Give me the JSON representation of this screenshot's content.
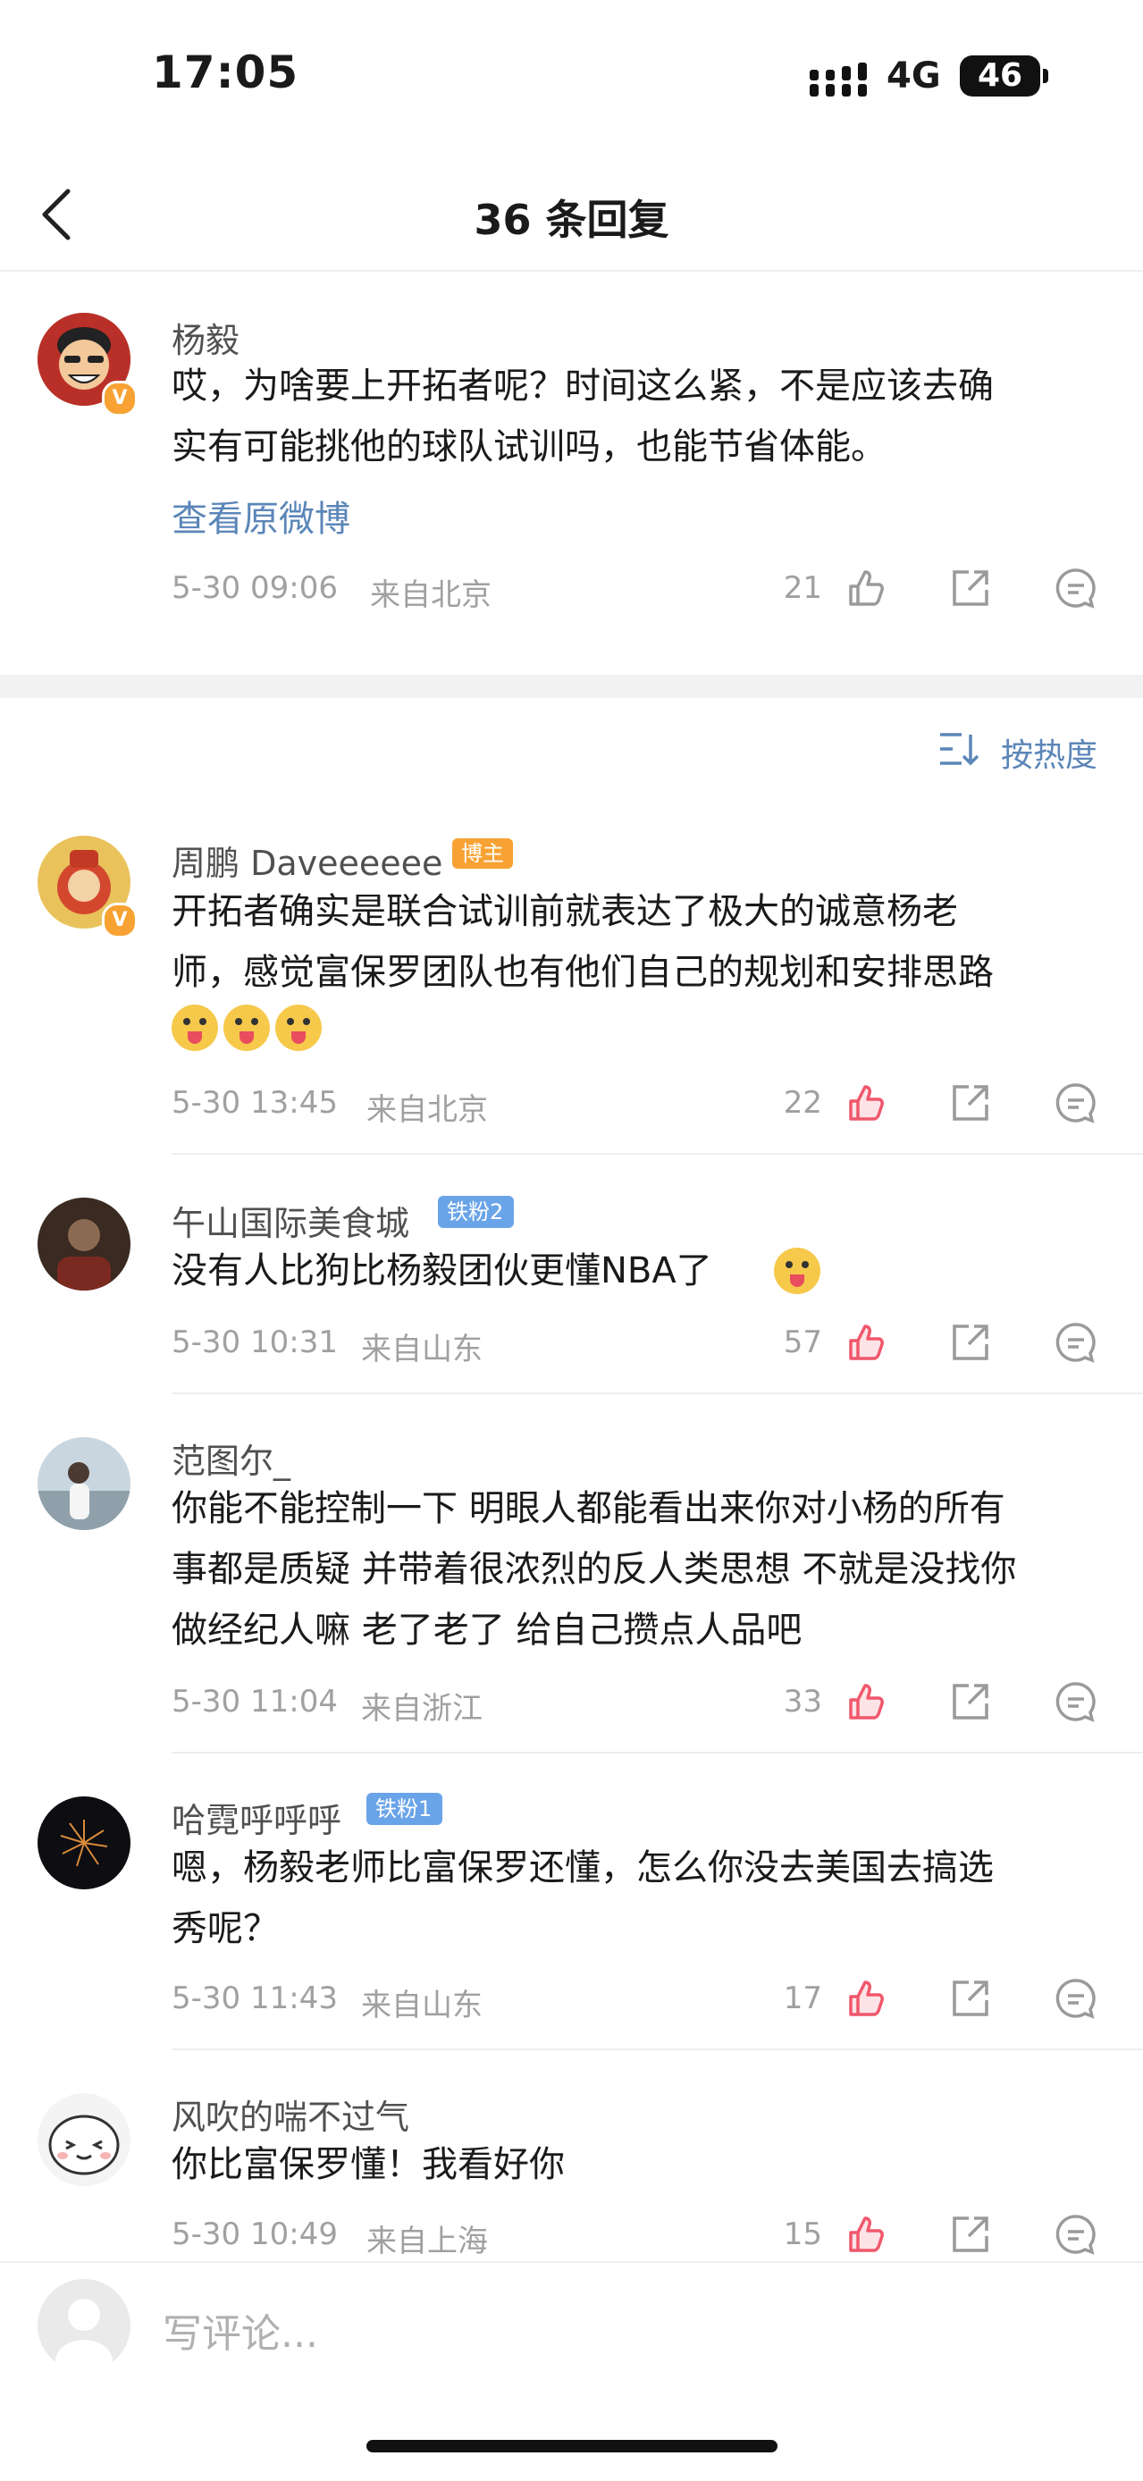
{
  "status_bar": {
    "time": "17:05",
    "network": "4G",
    "battery": "46"
  },
  "nav": {
    "title": "36 条回复"
  },
  "original": {
    "user": "杨毅",
    "text_line1": "哎，为啥要上开拓者呢？时间这么紧，不是应该去确",
    "text_line2": "实有可能挑他的球队试训吗，也能节省体能。",
    "view_link": "查看原微博",
    "date": "5-30 09:06",
    "location": "来自北京",
    "likes": "21"
  },
  "sort": {
    "label": "按热度"
  },
  "comments": [
    {
      "user": "周鹏 Daveeeeee",
      "badge": "博主",
      "lines": [
        "开拓者确实是联合试训前就表达了极大的诚意杨老",
        "师，感觉富保罗团队也有他们自己的规划和安排思路"
      ],
      "date": "5-30 13:45",
      "location": "来自北京",
      "likes": "22"
    },
    {
      "user": "午山国际美食城",
      "badge": "铁粉2",
      "lines": [
        "没有人比狗比杨毅团伙更懂NBA了"
      ],
      "date": "5-30 10:31",
      "location": "来自山东",
      "likes": "57"
    },
    {
      "user": "范图尔_",
      "badge": "",
      "lines": [
        "你能不能控制一下 明眼人都能看出来你对小杨的所有",
        "事都是质疑 并带着很浓烈的反人类思想 不就是没找你",
        "做经纪人嘛 老了老了 给自己攒点人品吧"
      ],
      "date": "5-30 11:04",
      "location": "来自浙江",
      "likes": "33"
    },
    {
      "user": "哈霓呼呼呼",
      "badge": "铁粉1",
      "lines": [
        "嗯，杨毅老师比富保罗还懂，怎么你没去美国去搞选",
        "秀呢？"
      ],
      "date": "5-30 11:43",
      "location": "来自山东",
      "likes": "17"
    },
    {
      "user": "风吹的喘不过气",
      "badge": "",
      "lines": [
        "你比富保罗懂！我看好你"
      ],
      "date": "5-30 10:49",
      "location": "来自上海",
      "likes": "15"
    }
  ],
  "input": {
    "placeholder": "写评论..."
  },
  "colors": {
    "link": "#5b86b8",
    "like_active": "#f0576b",
    "meta": "#a0a0a0",
    "badge_orange": "#f7a233",
    "badge_blue": "#6aa4e8"
  },
  "icons": [
    "back-icon",
    "thumbs-up-icon",
    "share-icon",
    "comment-icon",
    "sort-icon",
    "verified-icon"
  ]
}
